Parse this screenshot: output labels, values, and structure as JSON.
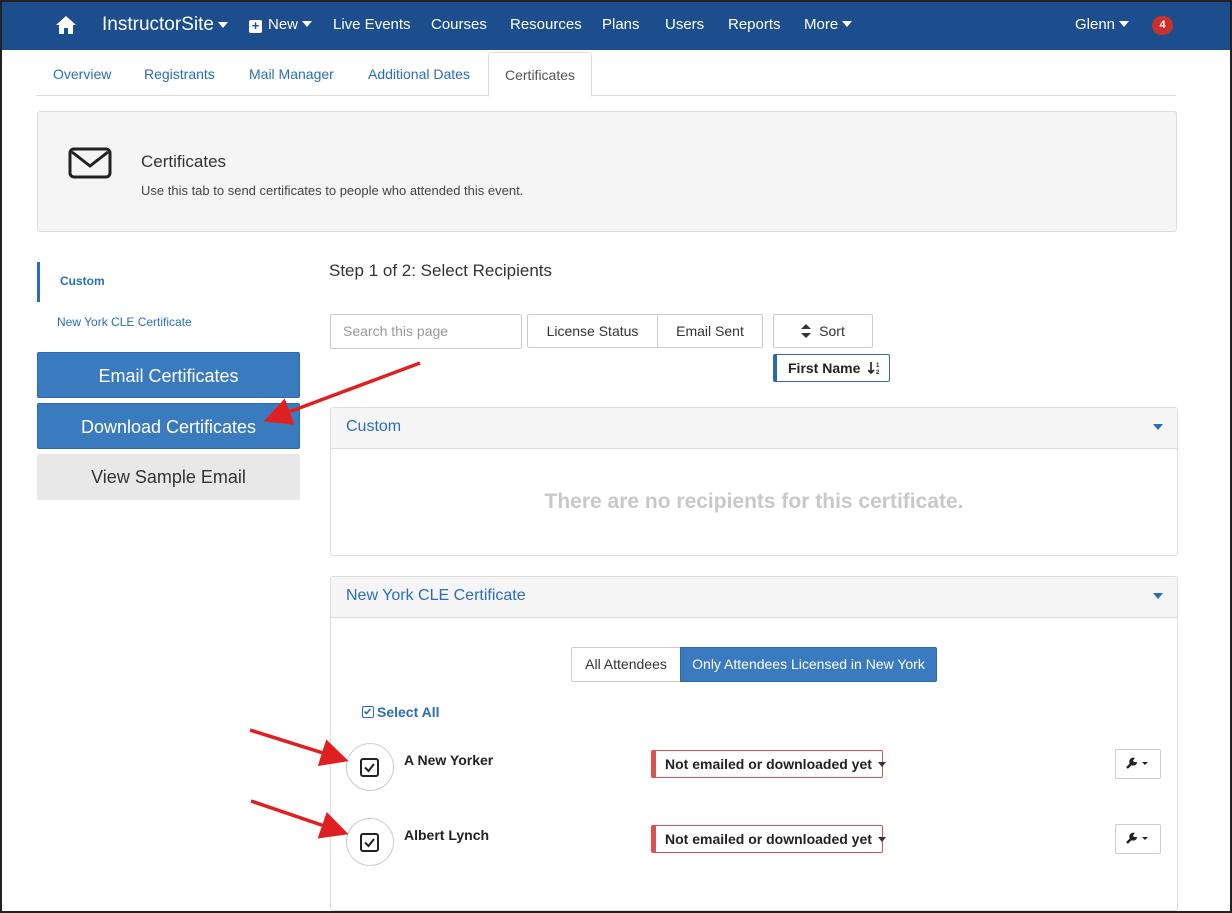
{
  "navbar": {
    "home_icon": "home-icon",
    "brand": "InstructorSite",
    "items": [
      "New",
      "Live Events",
      "Courses",
      "Resources",
      "Plans",
      "Users",
      "Reports",
      "More"
    ],
    "user": "Glenn",
    "notification_count": "4",
    "colors": {
      "background": "#1c4e8e",
      "badge": "#c9302c"
    }
  },
  "tabs": [
    "Overview",
    "Registrants",
    "Mail Manager",
    "Additional Dates",
    "Certificates"
  ],
  "active_tab": "Certificates",
  "info": {
    "icon": "envelope-icon",
    "title": "Certificates",
    "description": "Use this tab to send certificates to people who attended this event."
  },
  "sidebar": {
    "links": [
      "Custom",
      "New York CLE Certificate"
    ],
    "buttons": {
      "email": "Email Certificates",
      "download": "Download Certificates",
      "sample": "View Sample Email"
    }
  },
  "main": {
    "step_title": "Step 1 of 2: Select Recipients",
    "search_placeholder": "Search this page",
    "filters": [
      "License Status",
      "Email Sent"
    ],
    "sort_label": "Sort",
    "sort_field": "First Name",
    "panels": {
      "custom": {
        "title": "Custom",
        "empty_message": "There are no recipients for this certificate."
      },
      "ny": {
        "title": "New York CLE Certificate",
        "toggle": [
          "All Attendees",
          "Only Attendees Licensed in New York"
        ],
        "toggle_selected": "Only Attendees Licensed in New York",
        "select_all": "Select All",
        "recipients": [
          {
            "name": "A New Yorker",
            "checked": true,
            "status": "Not emailed or downloaded yet"
          },
          {
            "name": "Albert Lynch",
            "checked": true,
            "status": "Not emailed or downloaded yet"
          }
        ]
      }
    }
  },
  "annotation_color": "#e02020"
}
